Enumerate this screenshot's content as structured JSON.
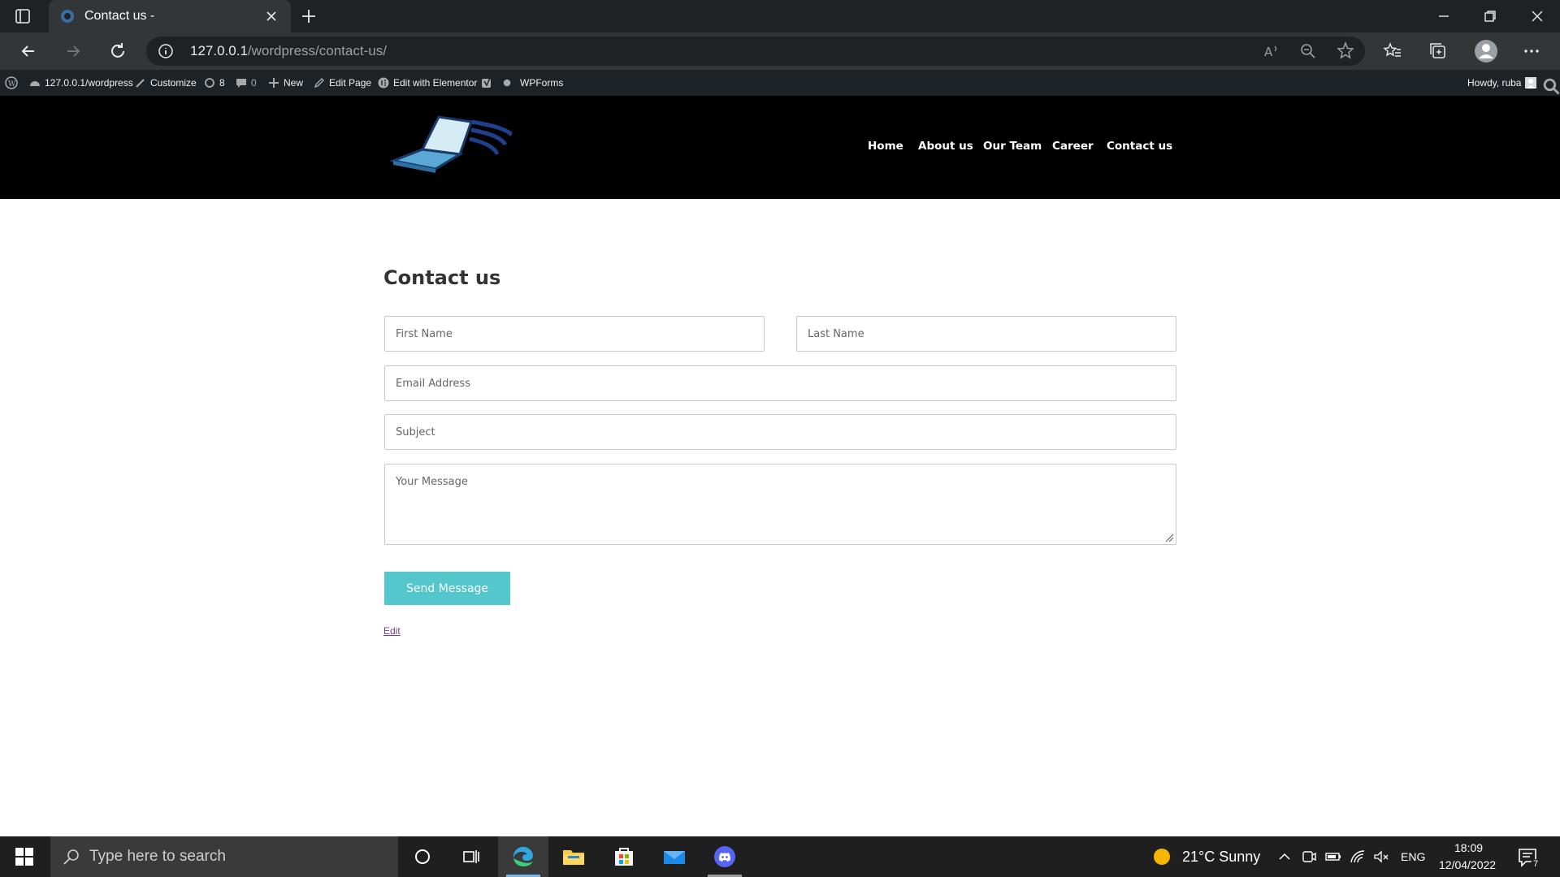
{
  "browser": {
    "tab_title": "Contact us -",
    "url_host": "127.0.0.1",
    "url_path": "/wordpress/contact-us/"
  },
  "adminbar": {
    "site": "127.0.0.1/wordpress",
    "customize": "Customize",
    "updates_count": "8",
    "comments_count": "0",
    "new": "New",
    "edit_page": "Edit Page",
    "edit_elementor": "Edit with Elementor",
    "wpforms": "WPForms",
    "howdy": "Howdy, ruba"
  },
  "site": {
    "nav": [
      "Home",
      "About us",
      "Our Team",
      "Career",
      "Contact us"
    ]
  },
  "content": {
    "title": "Contact us",
    "form": {
      "first_name_placeholder": "First Name",
      "last_name_placeholder": "Last Name",
      "email_placeholder": "Email Address",
      "subject_placeholder": "Subject",
      "message_placeholder": "Your Message",
      "submit_label": "Send Message"
    },
    "edit_link": "Edit"
  },
  "taskbar": {
    "search_placeholder": "Type here to search",
    "weather": "21°C  Sunny",
    "language": "ENG",
    "time": "18:09",
    "date": "12/04/2022",
    "notifications_count": "7"
  },
  "colors": {
    "accent_button": "#54c7cc",
    "header_bg": "#000000",
    "adminbar_bg": "#1d2327"
  }
}
